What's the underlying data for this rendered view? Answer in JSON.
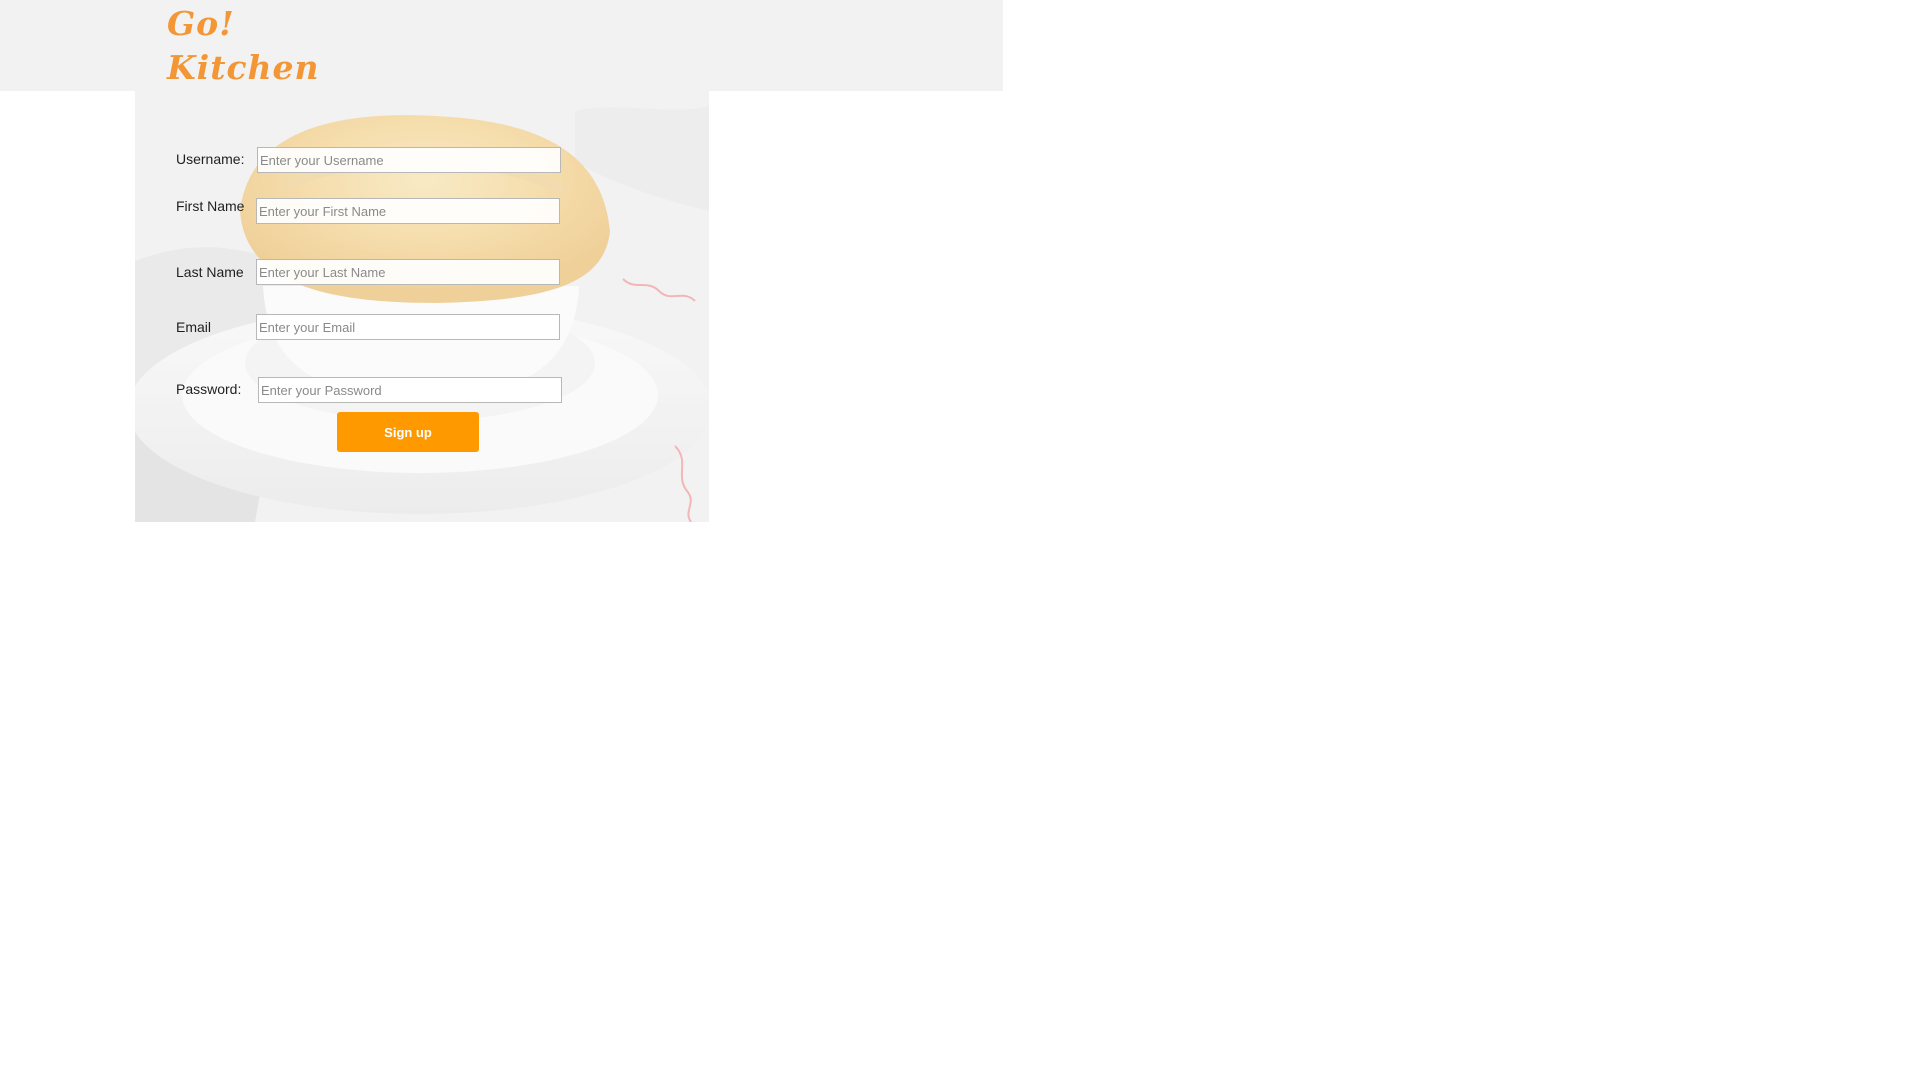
{
  "brand": {
    "logo_line1": "Go!",
    "logo_line2": "Kitchen",
    "logo_color": "#f39635"
  },
  "signup_form": {
    "username": {
      "label": "Username:",
      "placeholder": "Enter your Username",
      "value": ""
    },
    "first_name": {
      "label": "First Name",
      "placeholder": "Enter your First Name",
      "value": ""
    },
    "last_name": {
      "label": "Last Name",
      "placeholder": "Enter your Last Name",
      "value": ""
    },
    "email": {
      "label": "Email",
      "placeholder": "Enter your Email",
      "value": ""
    },
    "password": {
      "label": "Password:",
      "placeholder": "Enter your Password",
      "value": ""
    },
    "submit_label": "Sign up",
    "submit_color": "#ff9900"
  }
}
